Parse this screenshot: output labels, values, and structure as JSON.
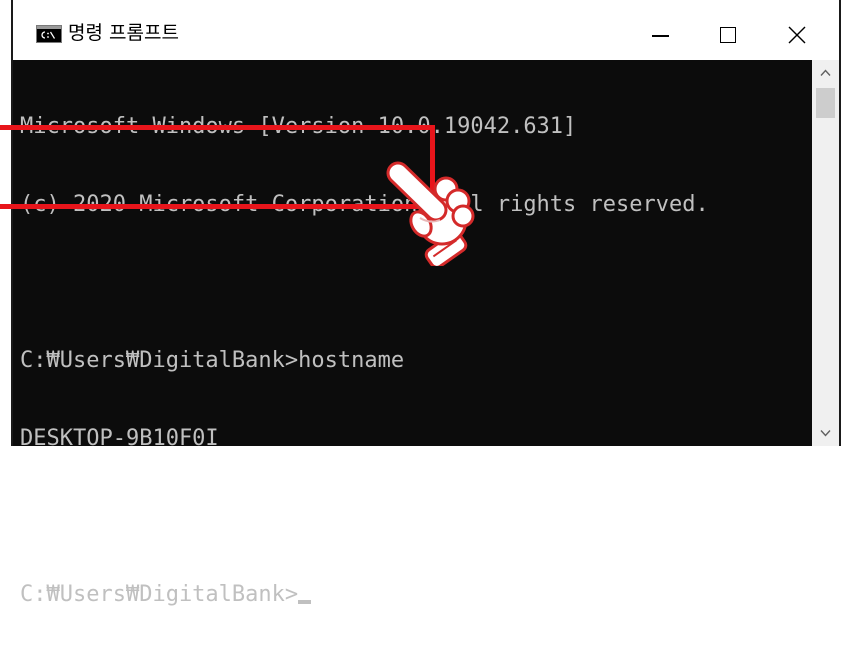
{
  "window": {
    "title": "명령 프롬프트",
    "icon": "cmd-icon"
  },
  "controls": {
    "minimize_icon": "minimize-icon",
    "maximize_icon": "maximize-icon",
    "close_icon": "close-icon"
  },
  "console": {
    "lines": [
      "Microsoft Windows [Version 10.0.19042.631]",
      "(c) 2020 Microsoft Corporation. All rights reserved.",
      "",
      "C:₩Users₩DigitalBank>hostname",
      "DESKTOP-9B10F0I",
      "",
      "C:₩Users₩DigitalBank>"
    ]
  },
  "scrollbar": {
    "position": 0,
    "up_icon": "chevron-up-icon",
    "down_icon": "chevron-down-icon"
  },
  "annotation": {
    "highlight": "highlight-box",
    "pointer_icon": "pointer-hand-icon"
  },
  "colors": {
    "console_background": "#0c0c0c",
    "console_text": "#c0c0c0",
    "annotation_red": "#e8151b"
  }
}
